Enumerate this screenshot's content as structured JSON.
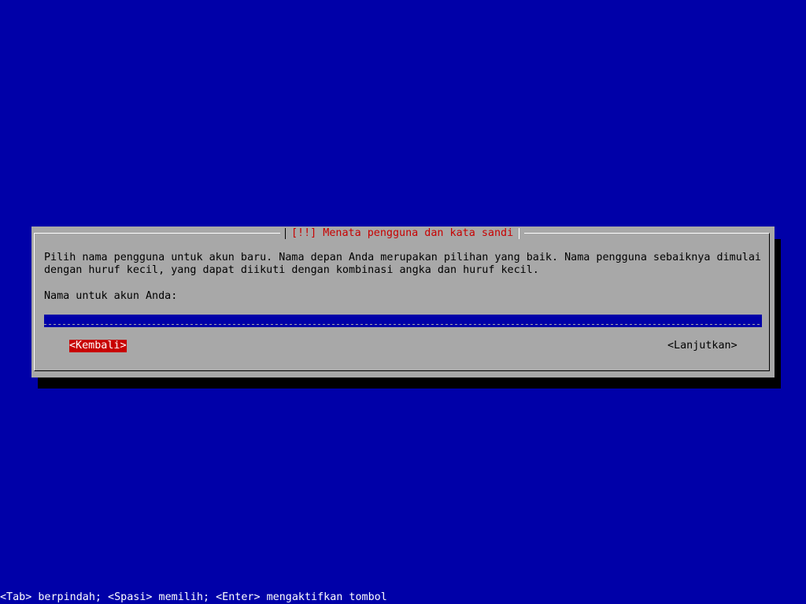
{
  "dialog": {
    "title": "[!!] Menata pengguna dan kata sandi",
    "description_lines": [
      "Pilih nama pengguna untuk akun baru. Nama depan Anda merupakan pilihan yang baik. Nama pengguna sebaiknya dimulai",
      "dengan huruf kecil, yang dapat diikuti dengan kombinasi angka dan huruf kecil."
    ],
    "field_label": "Nama untuk akun Anda:",
    "field_value": "",
    "back_button": "<Kembali>",
    "continue_button": "<Lanjutkan>"
  },
  "footer": {
    "help_text": "<Tab> berpindah; <Spasi> memilih; <Enter> mengaktifkan tombol"
  },
  "colors": {
    "background": "#0000a8",
    "dialog": "#a8a8a8",
    "title": "#c80000",
    "focus": "#c80000"
  }
}
